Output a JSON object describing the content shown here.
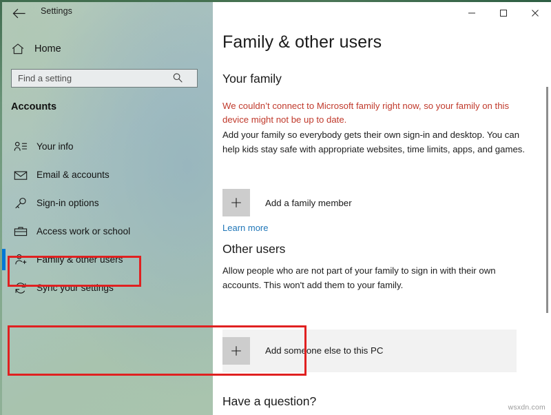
{
  "window": {
    "app_title": "Settings",
    "back_icon": "back-arrow-icon",
    "minimize_label": "—",
    "maximize_label": "□",
    "close_label": "✕"
  },
  "sidebar": {
    "home_label": "Home",
    "home_icon": "home-icon",
    "search": {
      "placeholder": "Find a setting",
      "value": "",
      "icon": "search-icon"
    },
    "section_title": "Accounts",
    "items": [
      {
        "label": "Your info",
        "icon": "person-info-icon",
        "selected": false
      },
      {
        "label": "Email & accounts",
        "icon": "envelope-icon",
        "selected": false
      },
      {
        "label": "Sign-in options",
        "icon": "key-icon",
        "selected": false
      },
      {
        "label": "Access work or school",
        "icon": "briefcase-icon",
        "selected": false
      },
      {
        "label": "Family & other users",
        "icon": "person-add-icon",
        "selected": true
      },
      {
        "label": "Sync your settings",
        "icon": "sync-icon",
        "selected": false
      }
    ],
    "selection_accent_color": "#0078d7"
  },
  "main": {
    "page_title": "Family & other users",
    "family": {
      "heading": "Your family",
      "warning": "We couldn’t connect to Microsoft family right now, so your family on this device might not be up to date.",
      "description": "Add your family so everybody gets their own sign-in and desktop. You can help kids stay safe with appropriate websites, time limits, apps, and games.",
      "add_button_label": "Add a family member",
      "add_button_icon": "plus-icon",
      "learn_more_label": "Learn more"
    },
    "other_users": {
      "heading": "Other users",
      "description": "Allow people who are not part of your family to sign in with their own accounts. This won't add them to your family.",
      "add_button_label": "Add someone else to this PC",
      "add_button_icon": "plus-icon"
    },
    "question_heading": "Have a question?"
  },
  "annotations": {
    "highlight_color": "#e02020",
    "sidebar_target": "Family & other users",
    "content_target": "Add someone else to this PC"
  },
  "watermark": "wsxdn.com",
  "colors": {
    "warning_text": "#c0392b",
    "link": "#1f76b8",
    "tile_plus_bg": "#cdcdcd",
    "tile_hover_bg": "#f2f2f2"
  }
}
